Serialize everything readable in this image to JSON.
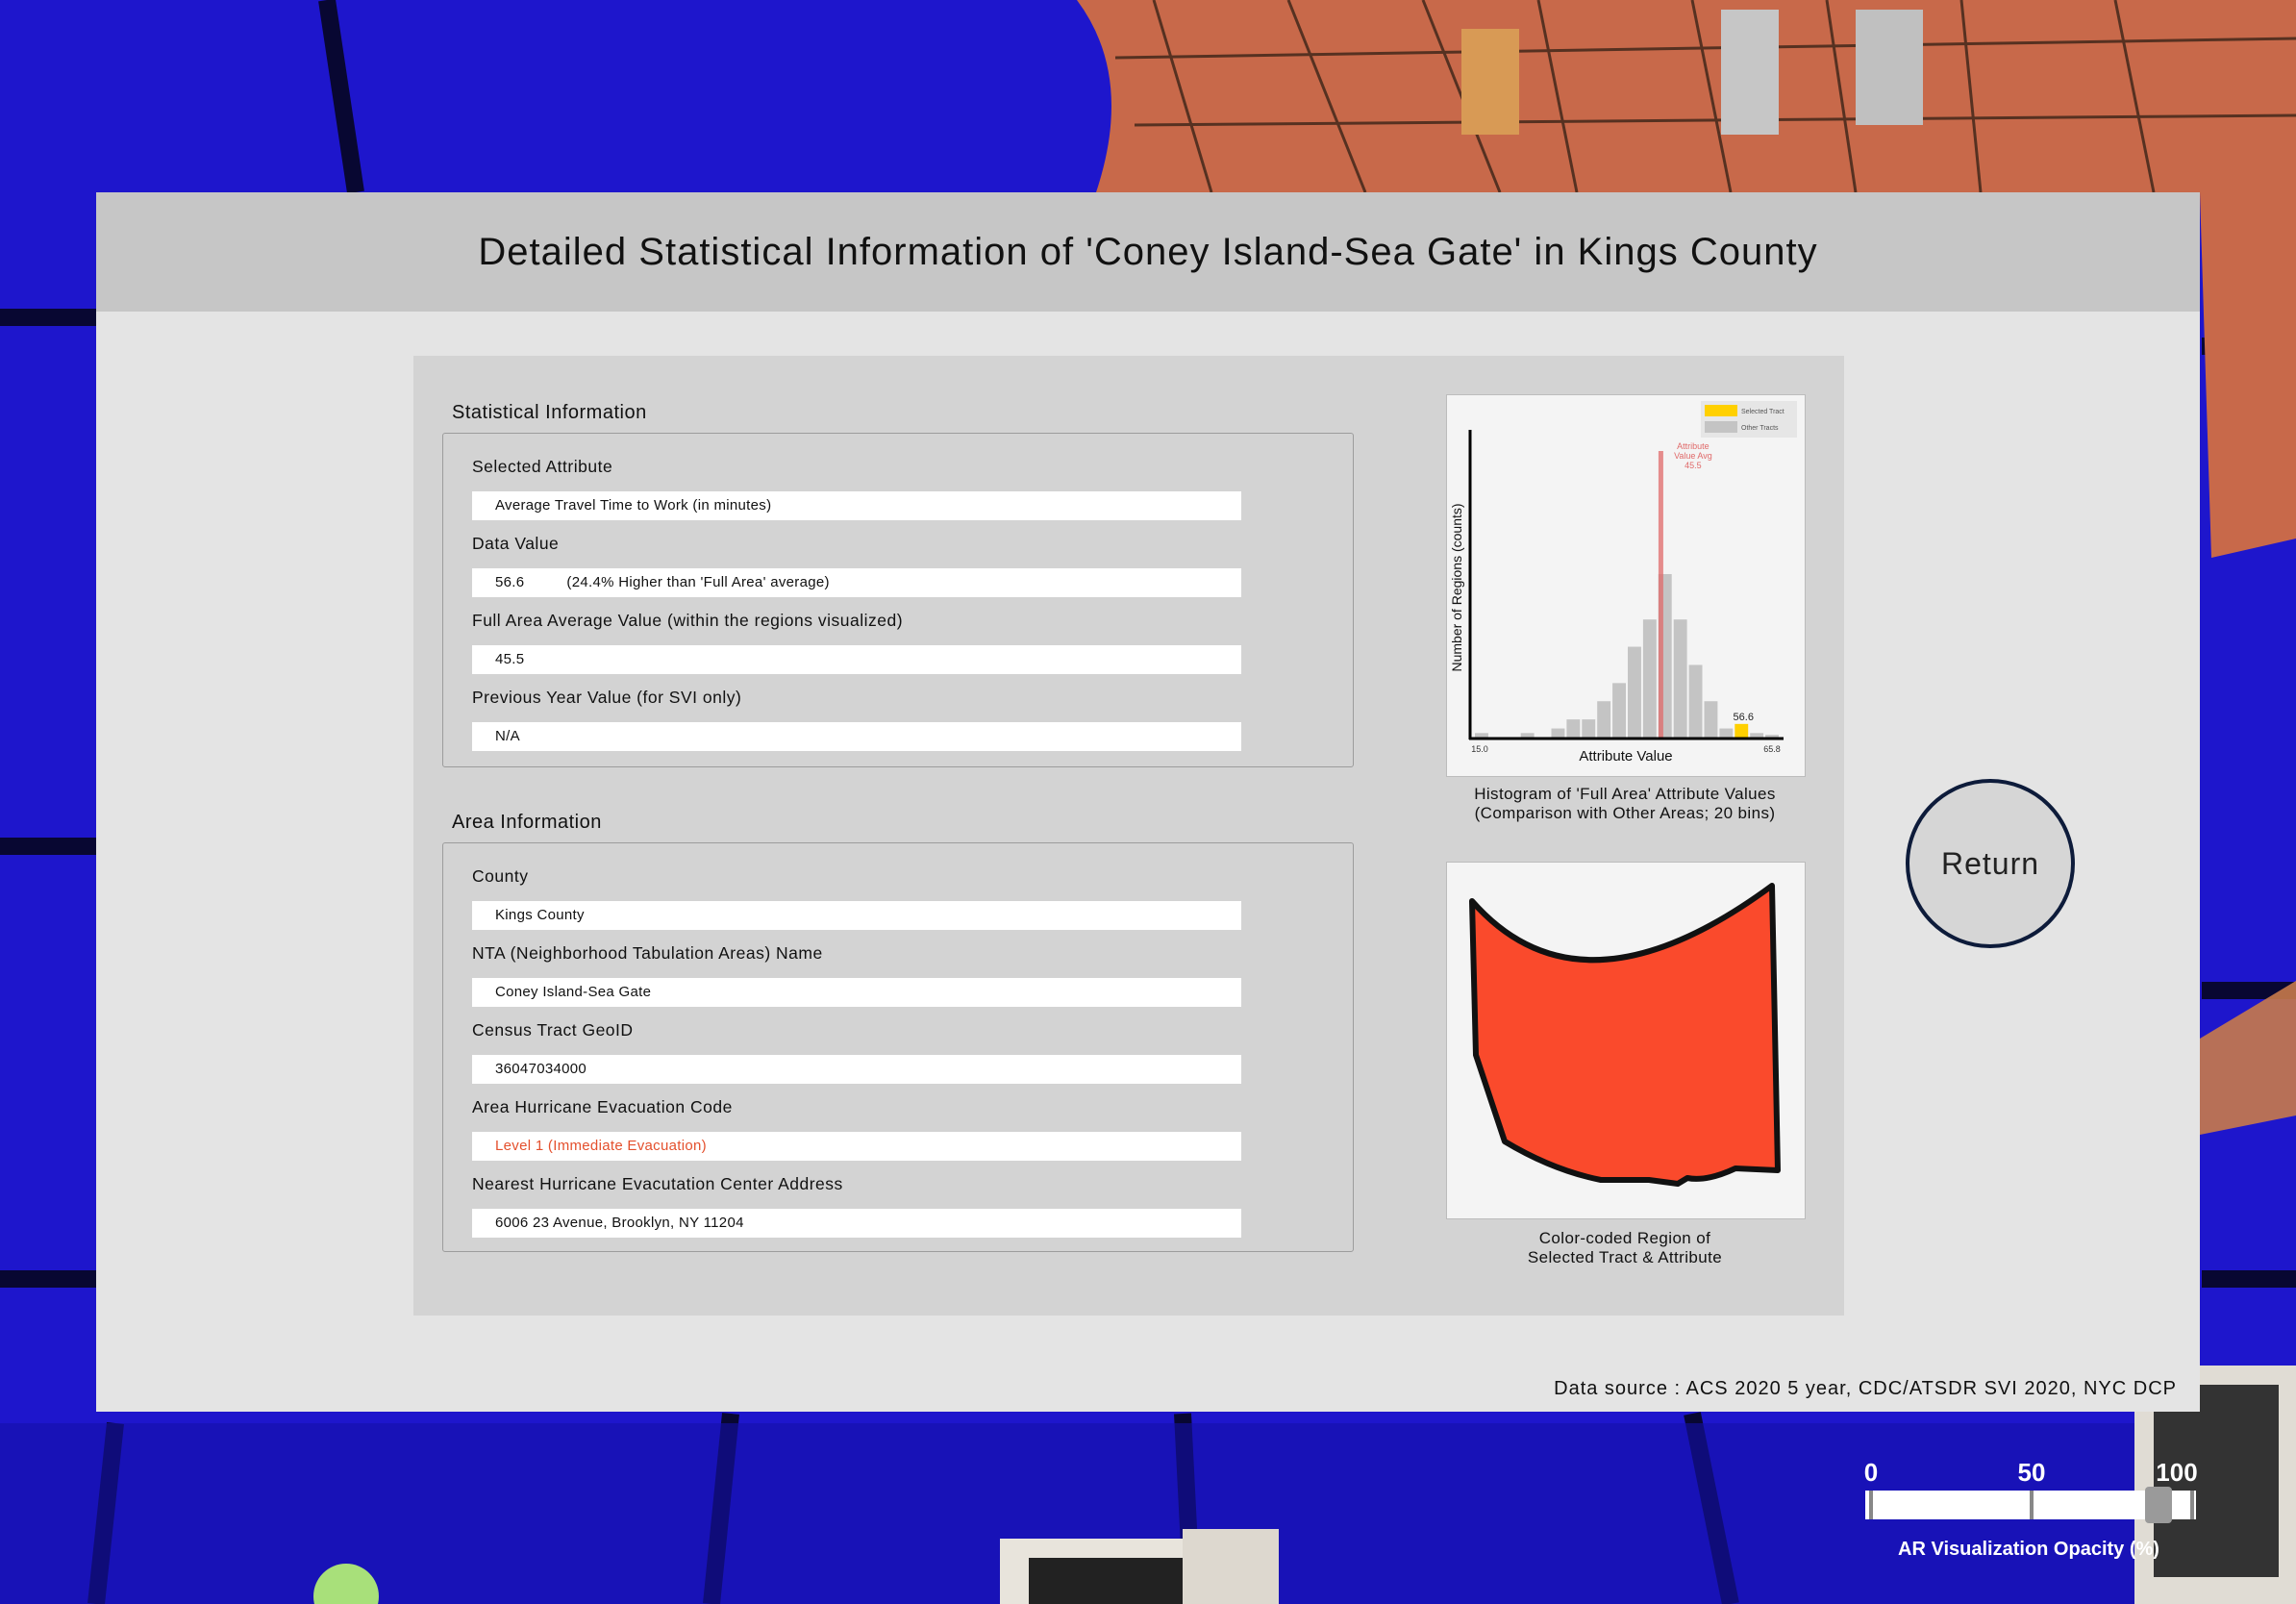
{
  "window": {
    "title": "Detailed Statistical Information of 'Coney Island-Sea Gate' in Kings County"
  },
  "statistical_info": {
    "section_title": "Statistical Information",
    "fields": [
      {
        "label": "Selected Attribute",
        "value": "Average Travel Time to Work (in minutes)"
      },
      {
        "label": "Data Value",
        "value": "56.6",
        "extra": "(24.4% Higher than 'Full Area' average)"
      },
      {
        "label": "Full Area Average Value (within the regions visualized)",
        "value": "45.5"
      },
      {
        "label": "Previous Year Value (for SVI only)",
        "value": "N/A"
      }
    ]
  },
  "area_info": {
    "section_title": "Area Information",
    "fields": [
      {
        "label": "County",
        "value": "Kings County"
      },
      {
        "label": "NTA (Neighborhood Tabulation Areas) Name",
        "value": "Coney Island-Sea Gate"
      },
      {
        "label": "Census Tract GeoID",
        "value": "36047034000"
      },
      {
        "label": "Area Hurricane Evacuation Code",
        "value": "Level 1 (Immediate Evacuation)"
      },
      {
        "label": "Nearest Hurricane Evacutation Center Address",
        "value": "6006 23 Avenue, Brooklyn, NY 11204"
      }
    ]
  },
  "histogram": {
    "caption_line1": "Histogram of 'Full Area' Attribute Values",
    "caption_line2": "(Comparison with Other Areas; 20 bins)"
  },
  "region_map": {
    "caption_line1": "Color-coded Region of",
    "caption_line2": "Selected Tract & Attribute",
    "fill_color": "#fa4a2c"
  },
  "return_button": {
    "label": "Return"
  },
  "source": "Data source : ACS 2020 5 year, CDC/ATSDR SVI 2020, NYC DCP",
  "opacity_slider": {
    "tick_labels": [
      "0",
      "50",
      "100"
    ],
    "caption": "AR Visualization Opacity (%)",
    "value_percent": 90
  },
  "colors": {
    "selected_bar": "#ffd000",
    "other_bars": "#c4c4c4",
    "avg_line": "#e06a6a",
    "alert_text": "#e4502d",
    "ar_background": "#1a12c8"
  },
  "chart_data": {
    "type": "bar",
    "xlabel": "Attribute Value",
    "ylabel": "Number of Regions (counts)",
    "x_min_label": "15.0",
    "x_max_label": "65.8",
    "xlim": [
      15.0,
      65.8
    ],
    "bins": 20,
    "counts": [
      0.5,
      0,
      0,
      0.5,
      0,
      1,
      2,
      2,
      4,
      6,
      10,
      13,
      18,
      13,
      8,
      4,
      1,
      1.5,
      0.5,
      0.3
    ],
    "selected_bin": 17,
    "selected_value_label": "56.6",
    "average_value": 45.5,
    "average_label": [
      "Attribute",
      "Value Avg",
      "45.5"
    ],
    "legend": [
      "Selected Tract",
      "Other Tracts"
    ],
    "legend_position": "top-right"
  }
}
